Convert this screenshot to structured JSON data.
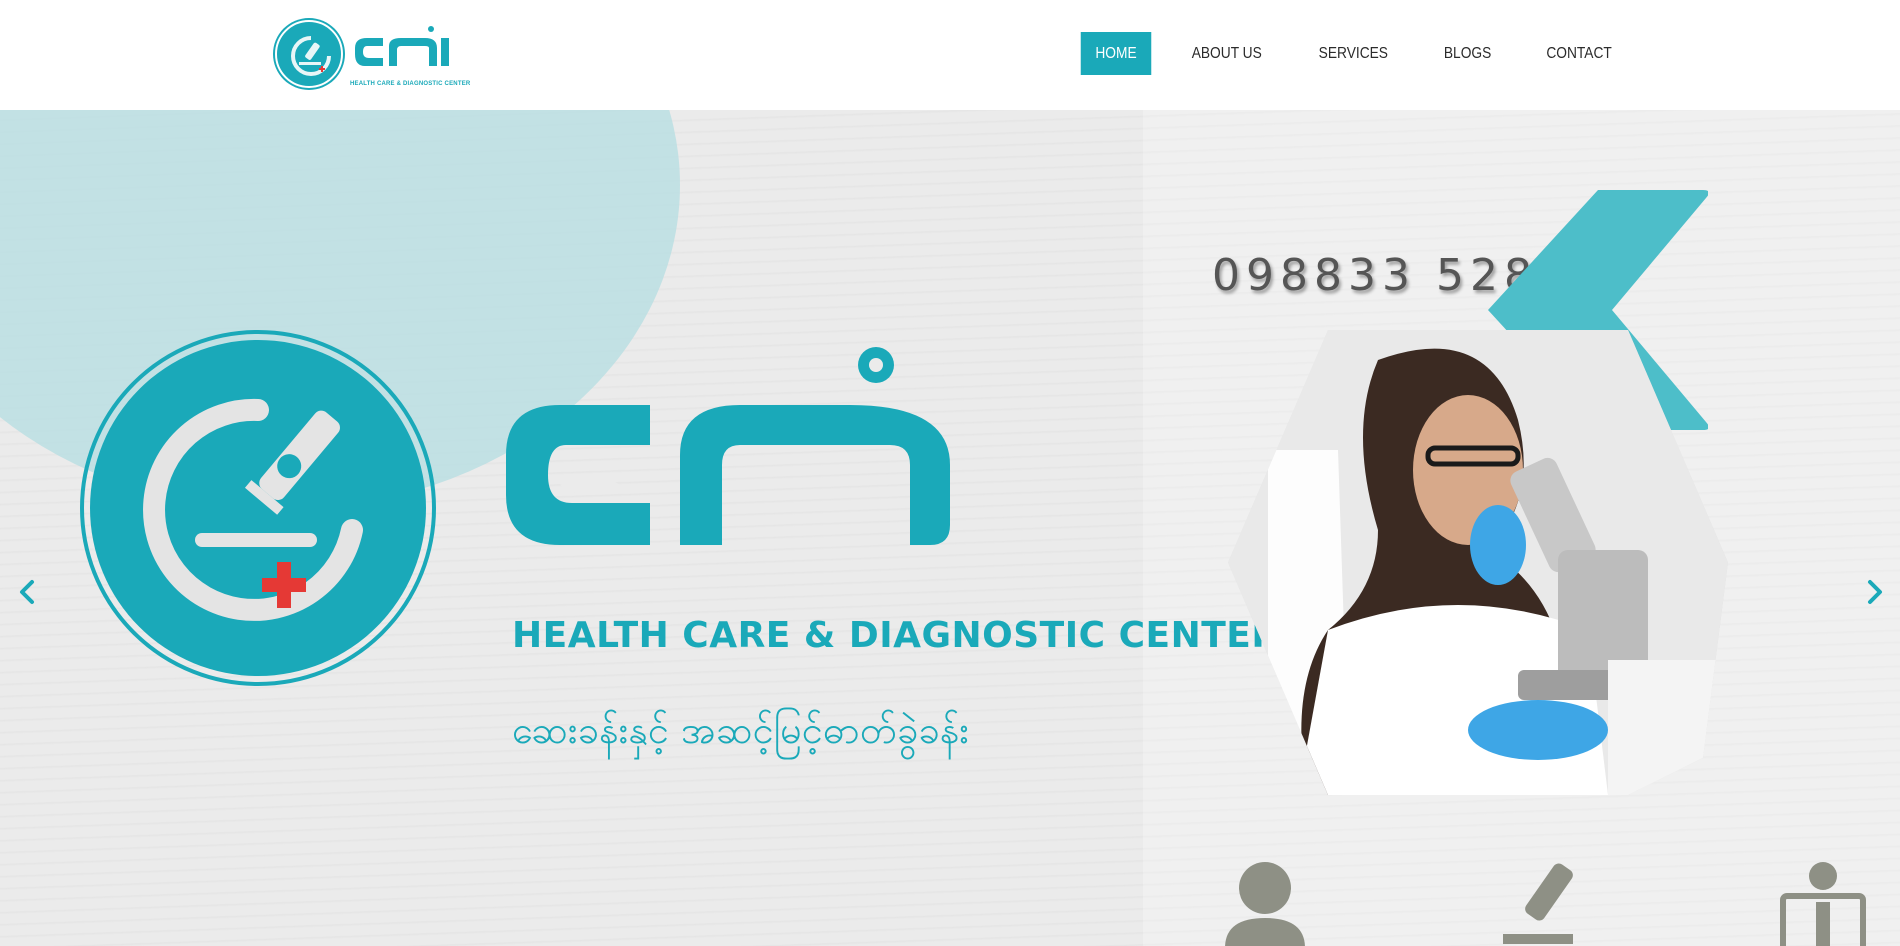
{
  "brand": {
    "logo_tagline": "HEALTH CARE & DIAGNOSTIC CENTER",
    "accent_color": "#1aa9b9"
  },
  "nav": {
    "items": [
      {
        "label": "HOME",
        "active": true
      },
      {
        "label": "ABOUT US",
        "active": false
      },
      {
        "label": "SERVICES",
        "active": false
      },
      {
        "label": "BLOGS",
        "active": false
      },
      {
        "label": "CONTACT",
        "active": false
      }
    ]
  },
  "hero": {
    "phone": "098833 528 33",
    "title_en": "HEALTH CARE & DIAGNOSTIC CENTER",
    "title_my": "ဆေးခန်းနှင့် အဆင့်မြင့်ဓာတ်ခွဲခန်း",
    "prev_icon": "chevron-left-icon",
    "next_icon": "chevron-right-icon",
    "bottom_icons": [
      "doctor-icon",
      "microscope-icon",
      "xray-icon"
    ]
  }
}
